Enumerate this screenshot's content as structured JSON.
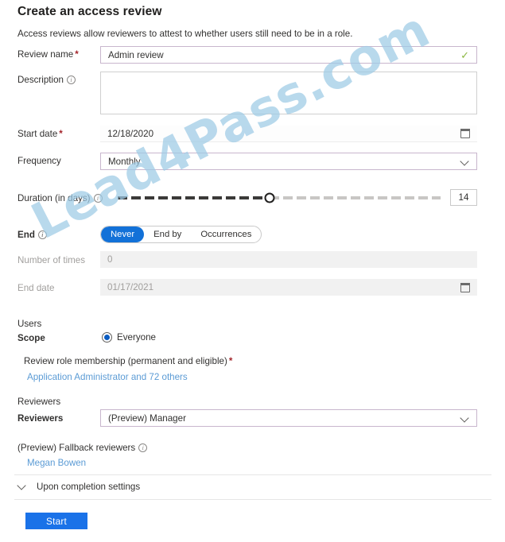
{
  "header": {
    "title": "Create an access review",
    "subtitle": "Access reviews allow reviewers to attest to whether users still need to be in a role."
  },
  "form": {
    "review_name": {
      "label": "Review name",
      "required_marker": "*",
      "value": "Admin review",
      "valid_icon": "check-icon"
    },
    "description": {
      "label": "Description",
      "info_icon": "info-icon",
      "value": "",
      "placeholder": ""
    },
    "start_date": {
      "label": "Start date",
      "required_marker": "*",
      "value": "12/18/2020",
      "icon": "calendar-icon"
    },
    "frequency": {
      "label": "Frequency",
      "value": "Monthly",
      "icon": "chevron-down-icon",
      "options": [
        "Monthly"
      ]
    },
    "duration": {
      "label": "Duration (in days)",
      "info_icon": "info-icon",
      "value": "14",
      "min": 1,
      "max": 30,
      "percent_filled": 47
    },
    "end": {
      "label": "End",
      "info_icon": "info-icon",
      "options": [
        "Never",
        "End by",
        "Occurrences"
      ],
      "selected": "Never"
    },
    "number_of_times": {
      "label": "Number of times",
      "value": "0",
      "disabled": true
    },
    "end_date": {
      "label": "End date",
      "value": "01/17/2021",
      "disabled": true,
      "icon": "calendar-icon"
    }
  },
  "users": {
    "section_label": "Users",
    "scope_label": "Scope",
    "scope_option": "Everyone",
    "scope_selected": true,
    "role_membership_label": "Review role membership (permanent and eligible)",
    "role_membership_required_marker": "*",
    "role_membership_link": "Application Administrator and 72 others"
  },
  "reviewers": {
    "section_label": "Reviewers",
    "field_label": "Reviewers",
    "value": "(Preview) Manager",
    "icon": "chevron-down-icon",
    "options": [
      "(Preview) Manager"
    ],
    "fallback_label": "(Preview) Fallback reviewers",
    "fallback_info_icon": "info-icon",
    "fallback_link": "Megan Bowen"
  },
  "completion": {
    "label": "Upon completion settings",
    "icon": "chevron-down-icon",
    "expanded": false
  },
  "footer": {
    "start_label": "Start"
  },
  "watermark": {
    "text": "Lead4Pass.com"
  },
  "colors": {
    "accent_blue": "#1a72e8",
    "pill_blue": "#1271d8",
    "link_blue": "#5b9bd5",
    "required_red": "#a4262c",
    "valid_green": "#8cb843",
    "field_purple": "#c8b6cd",
    "watermark_blue": "#9ecbe6"
  }
}
